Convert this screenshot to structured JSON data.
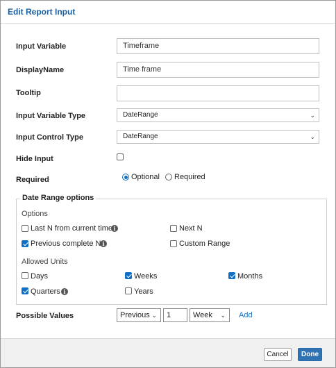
{
  "dialog": {
    "title": "Edit  Report Input"
  },
  "form": {
    "input_variable": {
      "label": "Input Variable",
      "value": "Timeframe"
    },
    "display_name": {
      "label": "DisplayName",
      "value": "Time frame"
    },
    "tooltip": {
      "label": "Tooltip",
      "value": ""
    },
    "input_variable_type": {
      "label": "Input Variable Type",
      "value": "DateRange"
    },
    "input_control_type": {
      "label": "Input Control Type",
      "value": "DateRange"
    },
    "hide_input": {
      "label": "Hide Input",
      "checked": false
    },
    "required": {
      "label": "Required",
      "options": [
        {
          "label": "Optional",
          "checked": true
        },
        {
          "label": "Required",
          "checked": false
        }
      ]
    }
  },
  "date_range": {
    "legend": "Date Range options",
    "options_heading": "Options",
    "options": [
      {
        "label": "Last N from current time",
        "checked": false,
        "info": true
      },
      {
        "label": "Next N",
        "checked": false,
        "info": false
      },
      {
        "label": "Previous complete N",
        "checked": true,
        "info": true
      },
      {
        "label": "Custom Range",
        "checked": false,
        "info": false
      }
    ],
    "units_heading": "Allowed Units",
    "units": [
      {
        "label": "Days",
        "checked": false,
        "info": false
      },
      {
        "label": "Weeks",
        "checked": true,
        "info": false
      },
      {
        "label": "Months",
        "checked": true,
        "info": false
      },
      {
        "label": "Quarters",
        "checked": true,
        "info": true
      },
      {
        "label": "Years",
        "checked": false,
        "info": false
      }
    ]
  },
  "possible_values": {
    "label": "Possible Values",
    "direction": "Previous",
    "count": "1",
    "unit": "Week",
    "add_label": "Add"
  },
  "footer": {
    "cancel_label": "Cancel",
    "done_label": "Done"
  },
  "icons": {
    "info": "info-icon",
    "dropdown": "chevron-down-icon"
  },
  "colors": {
    "accent": "#0e6fc4",
    "title": "#1a5fa0",
    "primary_button": "#2f73b5"
  }
}
